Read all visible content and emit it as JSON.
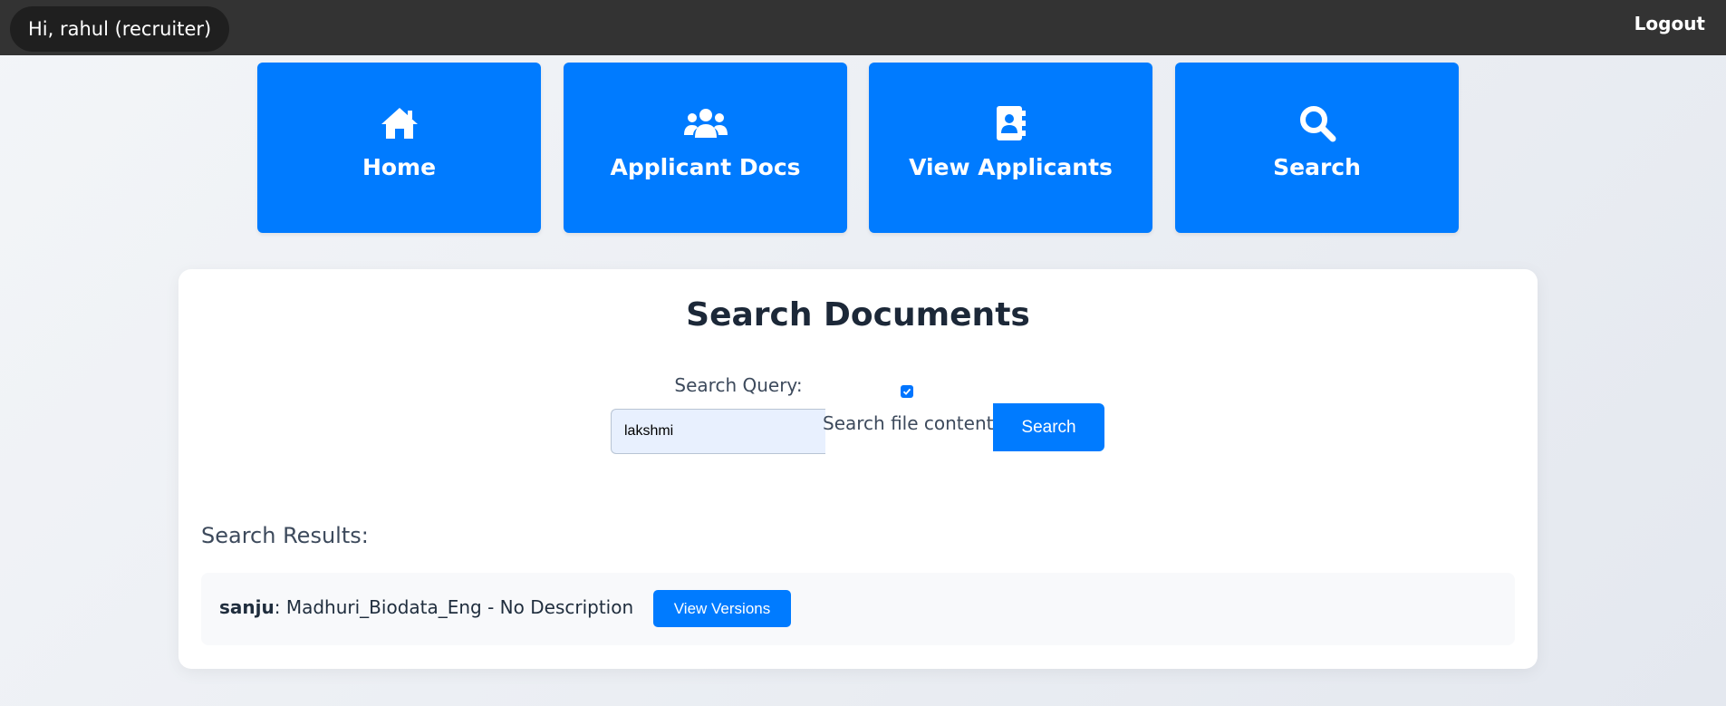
{
  "header": {
    "greeting": "Hi, rahul (recruiter)",
    "logout_label": "Logout"
  },
  "nav": {
    "tiles": [
      {
        "label": "Home",
        "icon": "home-icon"
      },
      {
        "label": "Applicant Docs",
        "icon": "users-icon"
      },
      {
        "label": "View Applicants",
        "icon": "address-book-icon"
      },
      {
        "label": "Search",
        "icon": "search-icon"
      }
    ]
  },
  "search": {
    "title": "Search Documents",
    "query_label": "Search Query:",
    "query_value": "lakshmi",
    "content_checkbox_checked": true,
    "content_checkbox_label": "Search file content",
    "button_label": "Search"
  },
  "results": {
    "heading": "Search Results:",
    "items": [
      {
        "user": "sanju",
        "separator": ":",
        "description": " Madhuri_Biodata_Eng - No Description",
        "button_label": "View Versions"
      }
    ]
  },
  "colors": {
    "accent": "#007bff",
    "topbar": "#333333",
    "greeting_bg": "#1f1f1f"
  }
}
